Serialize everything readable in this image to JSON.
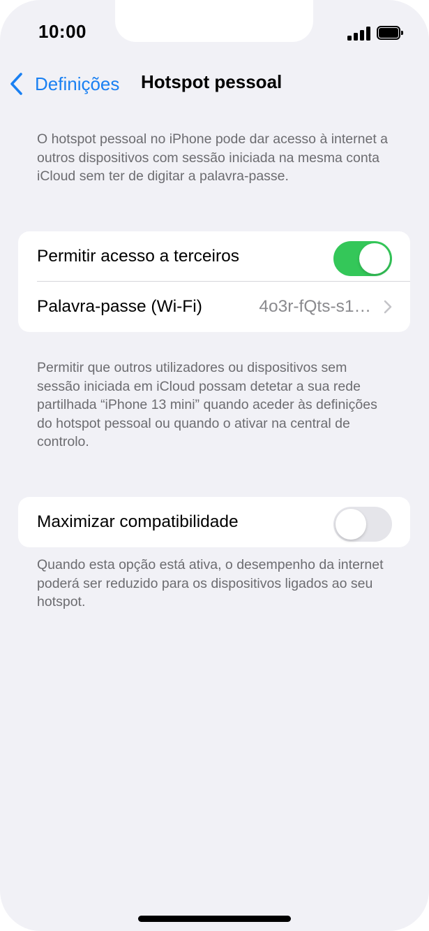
{
  "status_bar": {
    "time": "10:00",
    "signal_icon": "signal-bars-icon",
    "battery_icon": "battery-full-icon"
  },
  "nav": {
    "back_label": "Definições",
    "back_icon": "chevron-left-icon",
    "title": "Hotspot pessoal"
  },
  "intro_note": "O hotspot pessoal no iPhone pode dar acesso à internet a outros dispositivos com sessão iniciada na mesma conta iCloud sem ter de digitar a palavra-passe.",
  "group1": {
    "allow_others": {
      "label": "Permitir acesso a terceiros",
      "enabled": true
    },
    "wifi_password": {
      "label": "Palavra-passe (Wi-Fi)",
      "value": "4o3r-fQts-s1…"
    }
  },
  "group1_note": "Permitir que outros utilizadores ou dispositivos sem sessão iniciada em iCloud possam detetar a sua rede partilhada “iPhone 13 mini” quando aceder às definições do hotspot pessoal ou quando o ativar na central de controlo.",
  "group2": {
    "max_compat": {
      "label": "Maximizar compatibilidade",
      "enabled": false
    }
  },
  "group2_note": "Quando esta opção está ativa, o desempenho da internet poderá ser reduzido para os dispositivos ligados ao seu hotspot.",
  "colors": {
    "accent": "#1a80f2",
    "toggle_on": "#34c759",
    "toggle_off": "#e5e5ea",
    "background": "#f1f1f6"
  }
}
